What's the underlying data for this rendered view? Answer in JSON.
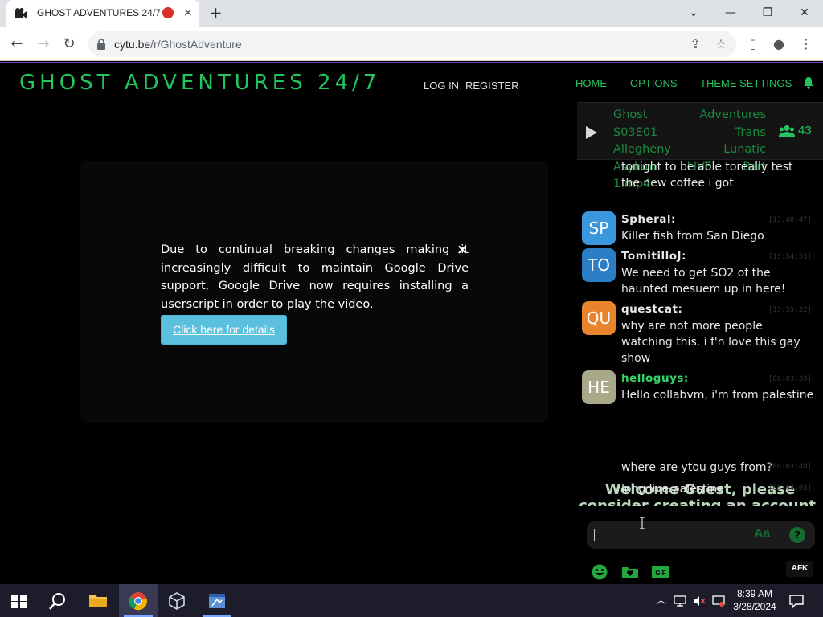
{
  "browser": {
    "tab_title": "GHOST ADVENTURES 24/7",
    "close_tab": "×",
    "new_tab": "+",
    "url_host": "cytu.be",
    "url_path": "/r/GhostAdventure"
  },
  "site": {
    "brand": "GHOST ADVENTURES 24/7",
    "login": "LOG IN",
    "register": "REGISTER",
    "nav": {
      "home": "HOME",
      "options": "OPTIONS",
      "theme_settings": "THEME SETTINGS"
    }
  },
  "video": {
    "alert_message": "Due to continual breaking changes making it increasingly difficult to maintain Google Drive support, Google Drive now requires installing a userscript in order to play the video.",
    "alert_close": "×",
    "details_button": "Click here for details"
  },
  "chat": {
    "now_playing": "Ghost Adventures S03E01 Trans Allegheny Lunatic Asylum LIVE Part 1.mp4",
    "user_count": "43",
    "partial_message": "tonight to be able toreally test the new coffee i got",
    "messages": [
      {
        "initials": "SP",
        "avatar_color": "#3a96dd",
        "username": "Spheral:",
        "timestamp": "[13:40:47]",
        "text": "Killer fish from San Diego"
      },
      {
        "initials": "TO",
        "avatar_color": "#2a7fc4",
        "username": "TomitilloJ:",
        "timestamp": "[13:54:53]",
        "text": "We need to get SO2 of the haunted mesuem up in here!"
      },
      {
        "initials": "QU",
        "avatar_color": "#e8842c",
        "username": "questcat:",
        "timestamp": "[13:55:32]",
        "text": "why are not more people watching this. i f'n love this gay show"
      },
      {
        "initials": "HE",
        "avatar_color": "#a9a98a",
        "username": "helloguys:",
        "timestamp": "[06:03:39]",
        "text": "Hello collabvm, i'm from palestine",
        "username_color": "#38d36a"
      }
    ],
    "trailing_messages": [
      {
        "timestamp": "[06:03:48]",
        "text": "where are ytou guys from?"
      },
      {
        "timestamp": "[06:04:03]",
        "text": "long live palestine"
      }
    ],
    "welcome": "Welcome Guest, please consider creating an account.",
    "input_value": "",
    "font_button": "Aa",
    "help_button": "?",
    "gif_button": "GIF",
    "afk_button": "AFK"
  },
  "taskbar": {
    "time": "8:39 AM",
    "date": "3/28/2024"
  },
  "colors": {
    "accent_green": "#22c55e",
    "dim_green": "#1a8a3e",
    "nav_border": "#6e3fb0",
    "button_blue": "#5bc0de"
  }
}
